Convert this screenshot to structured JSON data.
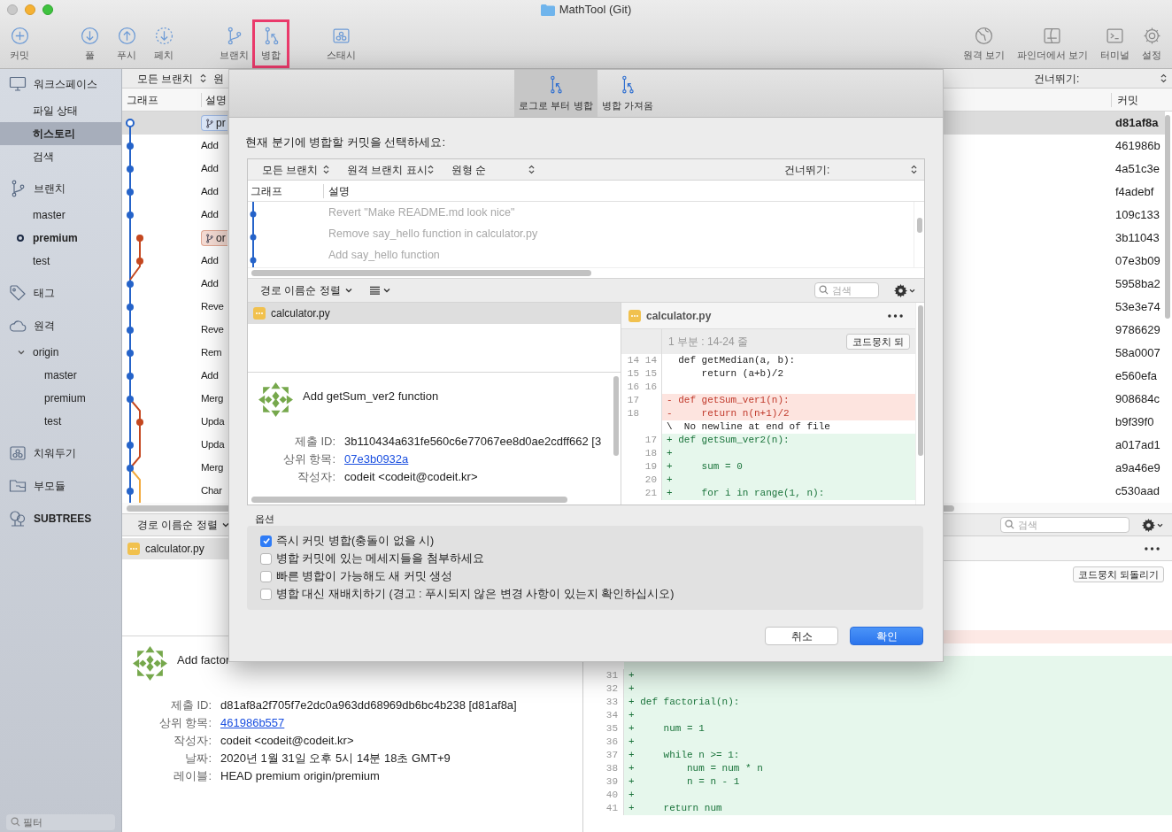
{
  "window": {
    "title": "MathTool (Git)"
  },
  "toolbar": [
    {
      "label": "커밋",
      "kind": "commit",
      "highlighted": false
    },
    {
      "label": "풀",
      "kind": "pull",
      "highlighted": false
    },
    {
      "label": "푸시",
      "kind": "push",
      "highlighted": false
    },
    {
      "label": "페치",
      "kind": "fetch",
      "highlighted": false
    },
    {
      "label": "브랜치",
      "kind": "branch",
      "highlighted": false
    },
    {
      "label": "병합",
      "kind": "merge",
      "highlighted": true
    },
    {
      "label": "스태시",
      "kind": "stash",
      "highlighted": false
    },
    {
      "label": "원격 보기",
      "kind": "remote",
      "highlighted": false
    },
    {
      "label": "파인더에서 보기",
      "kind": "finder",
      "highlighted": false
    },
    {
      "label": "터미널",
      "kind": "terminal",
      "highlighted": false
    },
    {
      "label": "설정",
      "kind": "settings",
      "highlighted": false
    }
  ],
  "sidebar": {
    "sections": [
      {
        "label": "워크스페이스",
        "kind": "workspace",
        "items": [
          {
            "label": "파일 상태",
            "selected": false
          },
          {
            "label": "히스토리",
            "selected": true
          },
          {
            "label": "검색",
            "selected": false
          }
        ]
      },
      {
        "label": "브랜치",
        "kind": "branches",
        "items": [
          {
            "label": "master",
            "selected": false,
            "current": false
          },
          {
            "label": "premium",
            "selected": false,
            "current": true
          },
          {
            "label": "test",
            "selected": false,
            "current": false
          }
        ]
      },
      {
        "label": "태그",
        "kind": "tags"
      },
      {
        "label": "원격",
        "kind": "remotes",
        "items": [
          {
            "label": "origin",
            "selected": false,
            "expanded": true,
            "children": [
              {
                "label": "master",
                "selected": false
              },
              {
                "label": "premium",
                "selected": false
              },
              {
                "label": "test",
                "selected": false
              }
            ]
          }
        ]
      },
      {
        "label": "치워두기",
        "kind": "stashes"
      },
      {
        "label": "부모듈",
        "kind": "submodules"
      },
      {
        "label": "SUBTREES",
        "kind": "subtrees"
      }
    ],
    "filter_placeholder": "필터"
  },
  "history": {
    "branch_filter": "모든 브랜치",
    "filter_2": "원",
    "skip_label": "건너뛰기:",
    "columns": [
      "그래프",
      "설명",
      "커밋"
    ],
    "rows": [
      {
        "badge": {
          "label": "pr",
          "kind": "local"
        },
        "commit": "d81af8a",
        "selected": true
      },
      {
        "description": "Add",
        "commit": "461986b",
        "selected": false
      },
      {
        "description": "Add",
        "commit": "4a51c3e",
        "selected": false
      },
      {
        "description": "Add",
        "commit": "f4adebf",
        "selected": false
      },
      {
        "description": "Add",
        "commit": "109c133",
        "selected": false
      },
      {
        "badge": {
          "label": "or",
          "kind": "remote"
        },
        "commit": "3b11043",
        "selected": false
      },
      {
        "description": "Add",
        "commit": "07e3b09",
        "selected": false
      },
      {
        "description": "Add",
        "commit": "5958ba2",
        "selected": false
      },
      {
        "description": "Reve",
        "commit": "53e3e74",
        "selected": false
      },
      {
        "description": "Reve",
        "commit": "9786629",
        "selected": false
      },
      {
        "description": "Rem",
        "commit": "58a0007",
        "selected": false
      },
      {
        "description": "Add",
        "commit": "e560efa",
        "selected": false
      },
      {
        "description": "Merg",
        "commit": "908684c",
        "selected": false
      },
      {
        "description": "Upda",
        "commit": "b9f39f0",
        "selected": false
      },
      {
        "description": "Upda",
        "commit": "a017ad1",
        "selected": false
      },
      {
        "description": "Merg",
        "commit": "a9a46e9",
        "selected": false
      },
      {
        "description": "Char",
        "commit": "c530aad",
        "selected": false
      }
    ],
    "sort_label": "경로 이름순 정렬",
    "search_placeholder": "검색",
    "files": [
      {
        "name": "calculator.py",
        "selected": true
      }
    ],
    "revert_button": "코드뭉치 되돌리기",
    "diff_lines": [
      {
        "number": "31",
        "text": "+"
      },
      {
        "number": "32",
        "text": "+"
      },
      {
        "number": "33",
        "text": "+ def factorial(n):"
      },
      {
        "number": "34",
        "text": "+"
      },
      {
        "number": "35",
        "text": "+     num = 1"
      },
      {
        "number": "36",
        "text": "+"
      },
      {
        "number": "37",
        "text": "+     while n >= 1:"
      },
      {
        "number": "38",
        "text": "+         num = num * n"
      },
      {
        "number": "39",
        "text": "+         n = n - 1"
      },
      {
        "number": "40",
        "text": "+"
      },
      {
        "number": "41",
        "text": "+     return num"
      }
    ],
    "commit": {
      "title": "Add factor",
      "fields": [
        {
          "label": "제출 ID:",
          "value": "d81af8a2f705f7e2dc0a963dd68969db6bc4b238 [d81af8a]",
          "kind": "text"
        },
        {
          "label": "상위 항목:",
          "value": "461986b557",
          "kind": "link"
        },
        {
          "label": "작성자:",
          "value": "codeit <codeit@codeit.kr>",
          "kind": "text"
        },
        {
          "label": "날짜:",
          "value": "2020년 1월 31일 오후 5시 14분 18초 GMT+9",
          "kind": "text"
        },
        {
          "label": "레이블:",
          "value": "HEAD premium origin/premium",
          "kind": "text"
        }
      ]
    }
  },
  "merge_dialog": {
    "tabs": [
      {
        "label": "로그로 부터 병합",
        "selected": true
      },
      {
        "label": "병합 가져옴",
        "selected": false
      }
    ],
    "prompt": "현재 분기에 병합할 커밋을 선택하세요:",
    "filters": [
      "모든 브랜치",
      "원격 브랜치 표시",
      "원형 순"
    ],
    "skip_label": "건너뛰기:",
    "columns": [
      "그래프",
      "설명"
    ],
    "commits": [
      "Revert \"Make README.md look nice\"",
      "Remove say_hello function in calculator.py",
      "Add say_hello function"
    ],
    "sort_label": "경로 이름순 정렬",
    "search_placeholder": "검색",
    "files": [
      {
        "name": "calculator.py",
        "selected": true
      }
    ],
    "commit": {
      "title": "Add getSum_ver2 function",
      "fields": [
        {
          "label": "제출 ID:",
          "value": "3b110434a631fe560c6e77067ee8d0ae2cdff662 [3",
          "kind": "text"
        },
        {
          "label": "상위 항목:",
          "value": "07e3b0932a",
          "kind": "link"
        },
        {
          "label": "작성자:",
          "value": "codeit <codeit@codeit.kr>",
          "kind": "text"
        }
      ]
    },
    "diff": {
      "file": "calculator.py",
      "hunk": "1 부분 : 14-24 줄",
      "revert_button": "코드뭉치 되",
      "lines": [
        {
          "old": "14",
          "new": "14",
          "kind": "context",
          "text": "  def getMedian(a, b):"
        },
        {
          "old": "15",
          "new": "15",
          "kind": "context",
          "text": "      return (a+b)/2"
        },
        {
          "old": "16",
          "new": "16",
          "kind": "context"
        },
        {
          "old": "17",
          "kind": "del",
          "text": "- def getSum_ver1(n):"
        },
        {
          "old": "18",
          "kind": "del",
          "text": "-     return n(n+1)/2"
        },
        {
          "kind": "note",
          "text": "\\  No newline at end of file"
        },
        {
          "new": "17",
          "kind": "add",
          "text": "+ def getSum_ver2(n):"
        },
        {
          "new": "18",
          "kind": "add",
          "text": "+"
        },
        {
          "new": "19",
          "kind": "add",
          "text": "+     sum = 0"
        },
        {
          "new": "20",
          "kind": "add",
          "text": "+"
        },
        {
          "new": "21",
          "kind": "add",
          "text": "+     for i in range(1, n):"
        }
      ]
    },
    "options_title": "옵션",
    "options": [
      {
        "label": "즉시 커밋 병합(충돌이 없을 시)",
        "checked": true
      },
      {
        "label": "병합 커밋에 있는 메세지들을 첨부하세요",
        "checked": false
      },
      {
        "label": "빠른 병합이 가능해도 새 커밋 생성",
        "checked": false
      },
      {
        "label": "병합 대신 재배치하기 (경고 : 푸시되지 않은 변경 사항이 있는지 확인하십시오)",
        "checked": false
      }
    ],
    "buttons": [
      {
        "label": "취소",
        "kind": "cancel"
      },
      {
        "label": "확인",
        "kind": "primary"
      }
    ]
  }
}
